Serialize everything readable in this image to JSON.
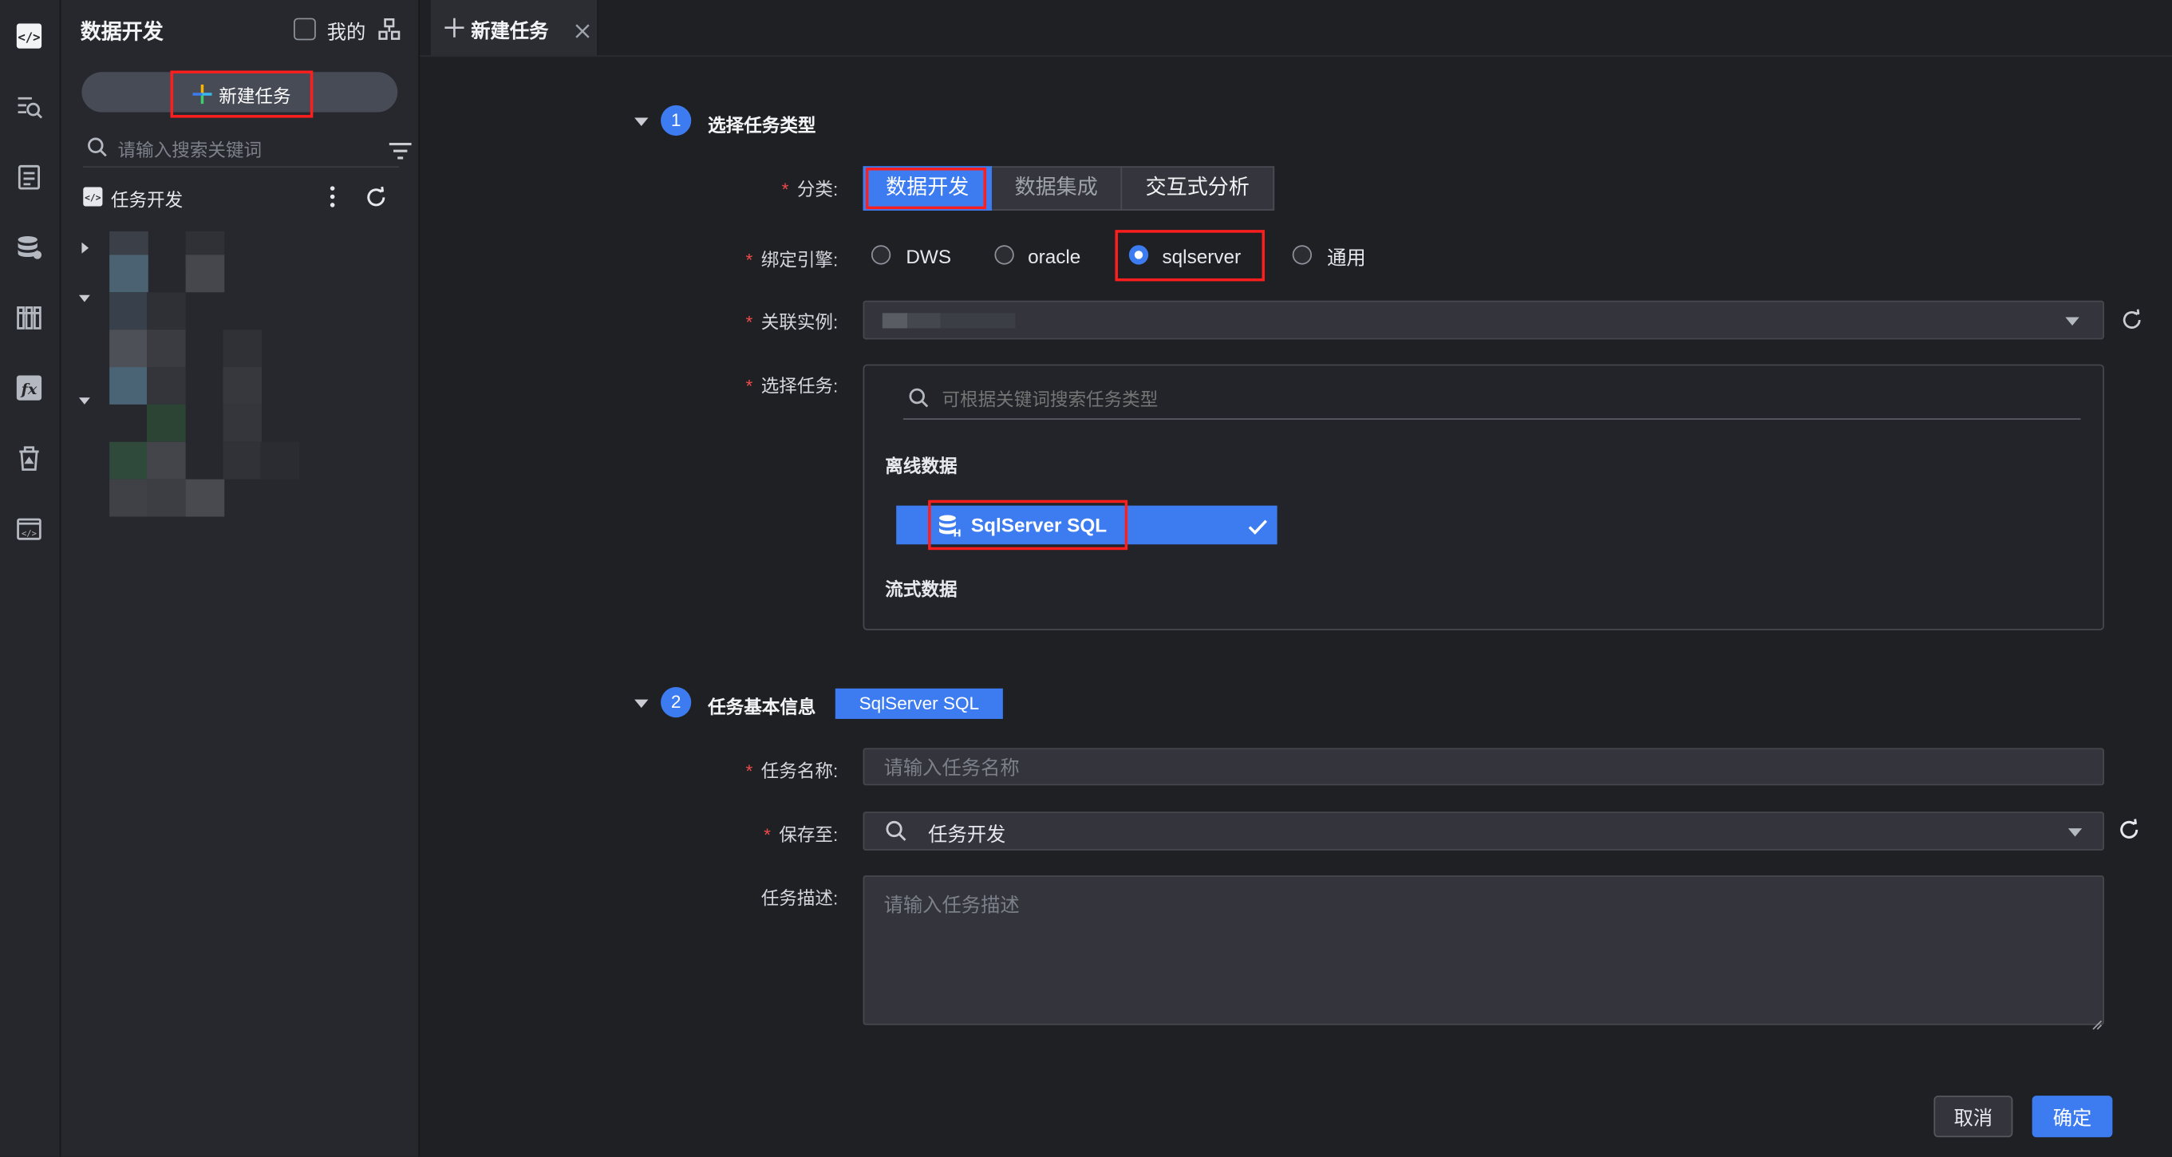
{
  "panel": {
    "title": "数据开发",
    "mine_label": "我的",
    "new_task_label": "新建任务",
    "search_placeholder": "请输入搜索关键词",
    "tree_root_label": "任务开发"
  },
  "tabs": [
    {
      "label": "新建任务",
      "active": true
    }
  ],
  "section1": {
    "step": "1",
    "title": "选择任务类型",
    "category": {
      "label": "分类:",
      "options": [
        "数据开发",
        "数据集成",
        "交互式分析"
      ],
      "selected": "数据开发"
    },
    "engine": {
      "label": "绑定引擎:",
      "options": [
        "DWS",
        "oracle",
        "sqlserver",
        "通用"
      ],
      "selected": "sqlserver"
    },
    "instance": {
      "label": "关联实例:"
    },
    "task_select": {
      "label": "选择任务:",
      "search_placeholder": "可根据关键词搜索任务类型",
      "group_offline": "离线数据",
      "selected_task": "SqlServer SQL",
      "group_stream": "流式数据"
    }
  },
  "section2": {
    "step": "2",
    "title": "任务基本信息",
    "type_tag": "SqlServer SQL",
    "name": {
      "label": "任务名称:",
      "placeholder": "请输入任务名称",
      "value": ""
    },
    "save_to": {
      "label": "保存至:",
      "value": "任务开发"
    },
    "description": {
      "label": "任务描述:",
      "placeholder": "请输入任务描述",
      "value": ""
    }
  },
  "footer": {
    "cancel_label": "取消",
    "confirm_label": "确定"
  },
  "colors": {
    "accent": "#3d7cf0",
    "required": "#f04b4b",
    "highlight_box": "#ff1e1e"
  }
}
